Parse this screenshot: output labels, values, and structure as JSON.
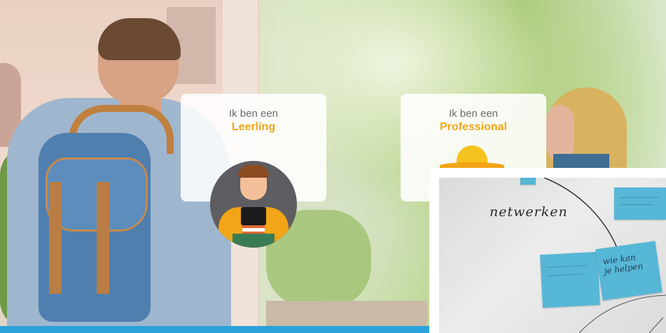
{
  "cards": {
    "leerling": {
      "prefix": "Ik ben een",
      "role": "Leerling"
    },
    "professional": {
      "prefix": "Ik ben een",
      "role": "Professional"
    }
  },
  "photo": {
    "whiteboard_text": "netwerken",
    "sticky_text": "wie kan\nje helpen"
  },
  "colors": {
    "accent": "#f2a516",
    "footer": "#2aa2da",
    "sticky": "#57b7d6"
  }
}
